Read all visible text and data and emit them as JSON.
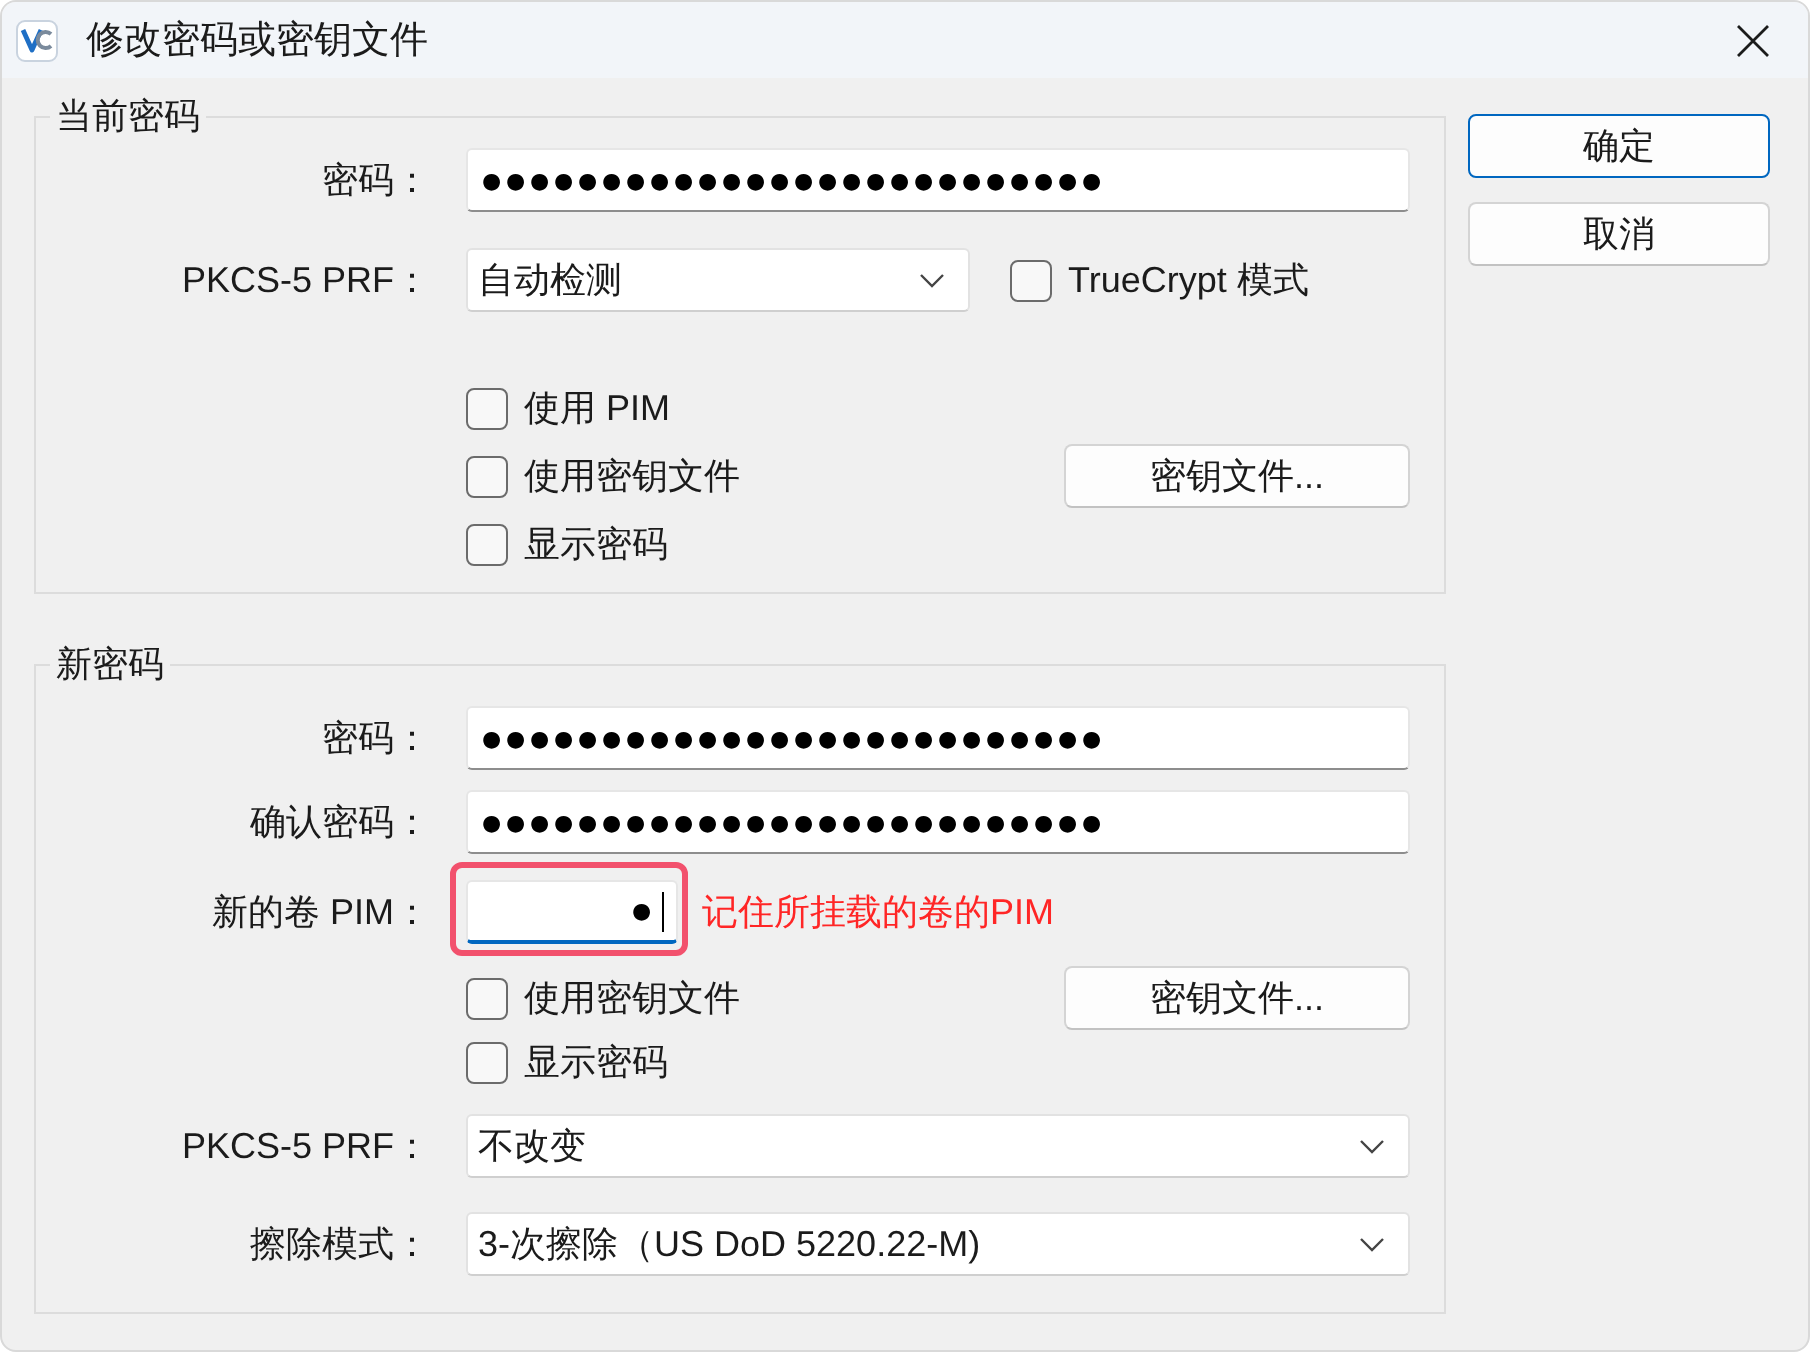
{
  "window": {
    "title": "修改密码或密钥文件"
  },
  "current_password": {
    "title": "当前密码",
    "password": {
      "label": "密码：",
      "value": "●●●●●●●●●●●●●●●●●●●●●●●●●●"
    },
    "prf": {
      "label": "PKCS-5 PRF：",
      "value": "自动检测"
    },
    "truecrypt_mode": {
      "label": "TrueCrypt 模式",
      "checked": false
    },
    "options": [
      {
        "label": "使用 PIM",
        "checked": false
      },
      {
        "label": "使用密钥文件",
        "checked": false,
        "button": "密钥文件..."
      },
      {
        "label": "显示密码",
        "checked": false
      }
    ]
  },
  "new_password": {
    "title": "新密码",
    "password": {
      "label": "密码：",
      "value": "●●●●●●●●●●●●●●●●●●●●●●●●●●"
    },
    "confirm": {
      "label": "确认密码：",
      "value": "●●●●●●●●●●●●●●●●●●●●●●●●●●"
    },
    "pim": {
      "label": "新的卷 PIM：",
      "value": "●",
      "focused": true
    },
    "annotation": "记住所挂载的卷的PIM",
    "options": [
      {
        "label": "使用密钥文件",
        "checked": false,
        "button": "密钥文件..."
      },
      {
        "label": "显示密码",
        "checked": false
      }
    ],
    "prf": {
      "label": "PKCS-5 PRF：",
      "value": "不改变"
    },
    "wipe_mode": {
      "label": "擦除模式：",
      "value": "3-次擦除（US DoD 5220.22-M)"
    }
  },
  "buttons": [
    {
      "label": "确定",
      "default": true
    },
    {
      "label": "取消",
      "default": false
    }
  ]
}
